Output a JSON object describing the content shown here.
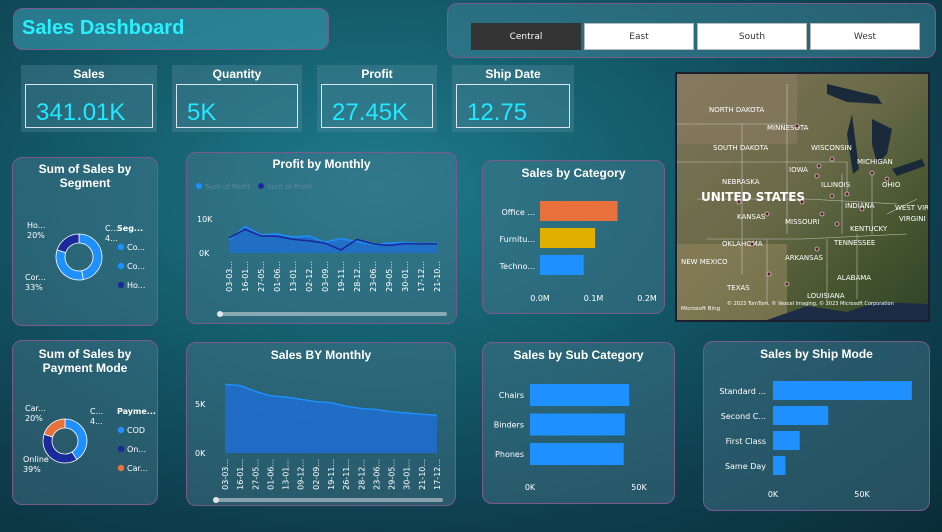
{
  "header": {
    "title": "Sales Dashboard"
  },
  "region_slicer": {
    "options": [
      "Central",
      "East",
      "South",
      "West"
    ],
    "selected": "Central"
  },
  "kpis": [
    {
      "label": "Sales",
      "value": "341.01K"
    },
    {
      "label": "Quantity",
      "value": "5K"
    },
    {
      "label": "Profit",
      "value": "27.45K"
    },
    {
      "label": "Ship Date",
      "value": "12.75"
    }
  ],
  "colors": {
    "accent": "#28f0ff",
    "bar_blue": "#1e90ff",
    "orange": "#e8703a",
    "gold": "#e0b000",
    "navy": "#1a2a9a",
    "area_fill": "#1e6fd9"
  },
  "map": {
    "label_country": "UNITED STATES",
    "states": [
      "NORTH DAKOTA",
      "MINNESOTA",
      "SOUTH DAKOTA",
      "WISCONSIN",
      "MICHIGAN",
      "IOWA",
      "NEBRASKA",
      "ILLINOIS",
      "INDIANA",
      "OHIO",
      "KANSAS",
      "MISSOURI",
      "KENTUCKY",
      "WEST VIRGINIA",
      "TENNESSEE",
      "OKLAHOMA",
      "ARKANSAS",
      "NEW MEXICO",
      "ALABAMA",
      "TEXAS",
      "LOUISIANA",
      "VIRGINIA",
      "VIRGINI"
    ],
    "attribution": "© 2023 TomTom, © Vexcel Imaging, © 2023 Microsoft Corporation",
    "logo": "Microsoft Bing"
  },
  "chart_data": [
    {
      "id": "segment",
      "type": "pie",
      "title": "Sum of Sales by Segment",
      "legend_title": "Seg...",
      "legend": [
        "Co...",
        "Co...",
        "Ho..."
      ],
      "slices": [
        {
          "name": "Consumer",
          "label": "C... 4...",
          "value": 47
        },
        {
          "name": "Corporate",
          "label": "Cor... 33%",
          "value": 33
        },
        {
          "name": "Home Office",
          "label": "Ho... 20%",
          "value": 20
        }
      ]
    },
    {
      "id": "profit_monthly",
      "type": "line",
      "title": "Profit by Monthly",
      "legend": [
        "Sum of Profit",
        "Sum of Profit"
      ],
      "x": [
        "03-03...",
        "16-01...",
        "27-05...",
        "01-06...",
        "13-01...",
        "02-12...",
        "03-09...",
        "19-11...",
        "28-12...",
        "23-06...",
        "29-05...",
        "30-01...",
        "17-12...",
        "21-10..."
      ],
      "yticks": [
        "10K",
        "0K"
      ],
      "series": [
        {
          "values": [
            3.5,
            7.0,
            4.8,
            5.0,
            4.2,
            4.5,
            2.8,
            3.8,
            3.0,
            2.2,
            2.6,
            2.8,
            2.5,
            2.6
          ]
        },
        {
          "values": [
            4.0,
            6.2,
            4.5,
            4.4,
            3.6,
            3.2,
            2.6,
            0.8,
            3.6,
            2.4,
            2.0,
            2.5,
            2.4,
            2.4
          ]
        }
      ]
    },
    {
      "id": "category",
      "type": "bar",
      "title": "Sales by Category",
      "categories": [
        "Office ...",
        "Furnitu...",
        "Techno..."
      ],
      "values": [
        0.145,
        0.103,
        0.082
      ],
      "colors": [
        "#e8703a",
        "#e0b000",
        "#1e90ff"
      ],
      "xticks": [
        "0.0M",
        "0.1M",
        "0.2M"
      ],
      "xlim": [
        0,
        0.2
      ]
    },
    {
      "id": "payment",
      "type": "pie",
      "title": "Sum of Sales by Payment Mode",
      "legend_title": "Payme...",
      "legend": [
        "COD",
        "On...",
        "Car..."
      ],
      "slices": [
        {
          "name": "COD",
          "label": "C... 4...",
          "value": 41
        },
        {
          "name": "Online",
          "label": "Online 39%",
          "value": 39
        },
        {
          "name": "Card",
          "label": "Car... 20%",
          "value": 20
        }
      ]
    },
    {
      "id": "sales_monthly",
      "type": "area",
      "title": "Sales BY Monthly",
      "x": [
        "03-03...",
        "16-01...",
        "27-05...",
        "01-06...",
        "13-01...",
        "09-12...",
        "02-09...",
        "19-11...",
        "26-11...",
        "28-12...",
        "23-06...",
        "29-05...",
        "30-01...",
        "21-10...",
        "17-12..."
      ],
      "yticks": [
        "5K",
        "0K"
      ],
      "values": [
        6.0,
        5.9,
        5.4,
        5.0,
        4.9,
        4.7,
        4.5,
        4.4,
        4.1,
        3.9,
        3.8,
        3.6,
        3.5,
        3.4,
        3.3
      ]
    },
    {
      "id": "sub_category",
      "type": "bar",
      "title": "Sales by Sub Category",
      "categories": [
        "Chairs",
        "Binders",
        "Phones"
      ],
      "values": [
        45.5,
        43.5,
        43.0
      ],
      "xticks": [
        "0K",
        "50K"
      ],
      "xlim": [
        0,
        50
      ]
    },
    {
      "id": "ship_mode",
      "type": "bar",
      "title": "Sales by Ship Mode",
      "categories": [
        "Standard ...",
        "Second C...",
        "First Class",
        "Same Day"
      ],
      "values": [
        78,
        31,
        15,
        7
      ],
      "xticks": [
        "0K",
        "50K"
      ],
      "xlim": [
        0,
        50
      ]
    }
  ]
}
